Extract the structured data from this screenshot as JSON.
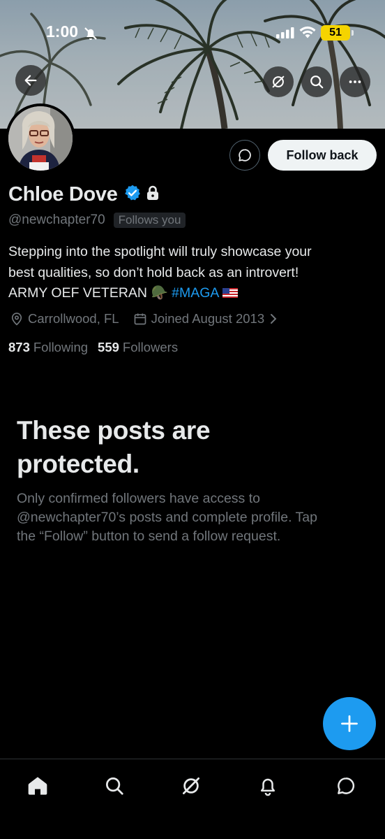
{
  "status_bar": {
    "time": "1:00",
    "battery": "51",
    "battery_color": "#f5d400"
  },
  "header": {
    "back_icon": "arrow-left-icon",
    "grok_icon": "grok-icon",
    "search_icon": "search-icon",
    "more_icon": "more-icon"
  },
  "profile": {
    "name": "Chloe Dove",
    "handle": "@newchapter70",
    "follows_you": "Follows you",
    "bio_line1": "Stepping into the spotlight will truly showcase your",
    "bio_line2": "best qualities, so don’t hold back as an introvert!",
    "bio_line3_prefix": "ARMY OEF VETERAN",
    "bio_helmet": "🪖",
    "bio_hashtag": "#MAGA",
    "location": "Carrollwood, FL",
    "joined": "Joined August 2013",
    "following_count": "873",
    "following_label": "Following",
    "followers_count": "559",
    "followers_label": "Followers"
  },
  "actions": {
    "follow_back": "Follow back"
  },
  "protected": {
    "title_line1": "These posts are",
    "title_line2": "protected.",
    "body_line1": "Only confirmed followers have access to",
    "body_line2": "@newchapter70’s posts and complete profile. Tap",
    "body_line3": "the “Follow” button to send a follow request."
  },
  "colors": {
    "accent": "#1d9bf0",
    "background": "#000000",
    "text_primary": "#e7e9ea",
    "text_secondary": "#71767b"
  },
  "bottom_nav": {
    "items": [
      "home-icon",
      "search-icon",
      "grok-icon",
      "notifications-icon",
      "messages-icon"
    ]
  }
}
